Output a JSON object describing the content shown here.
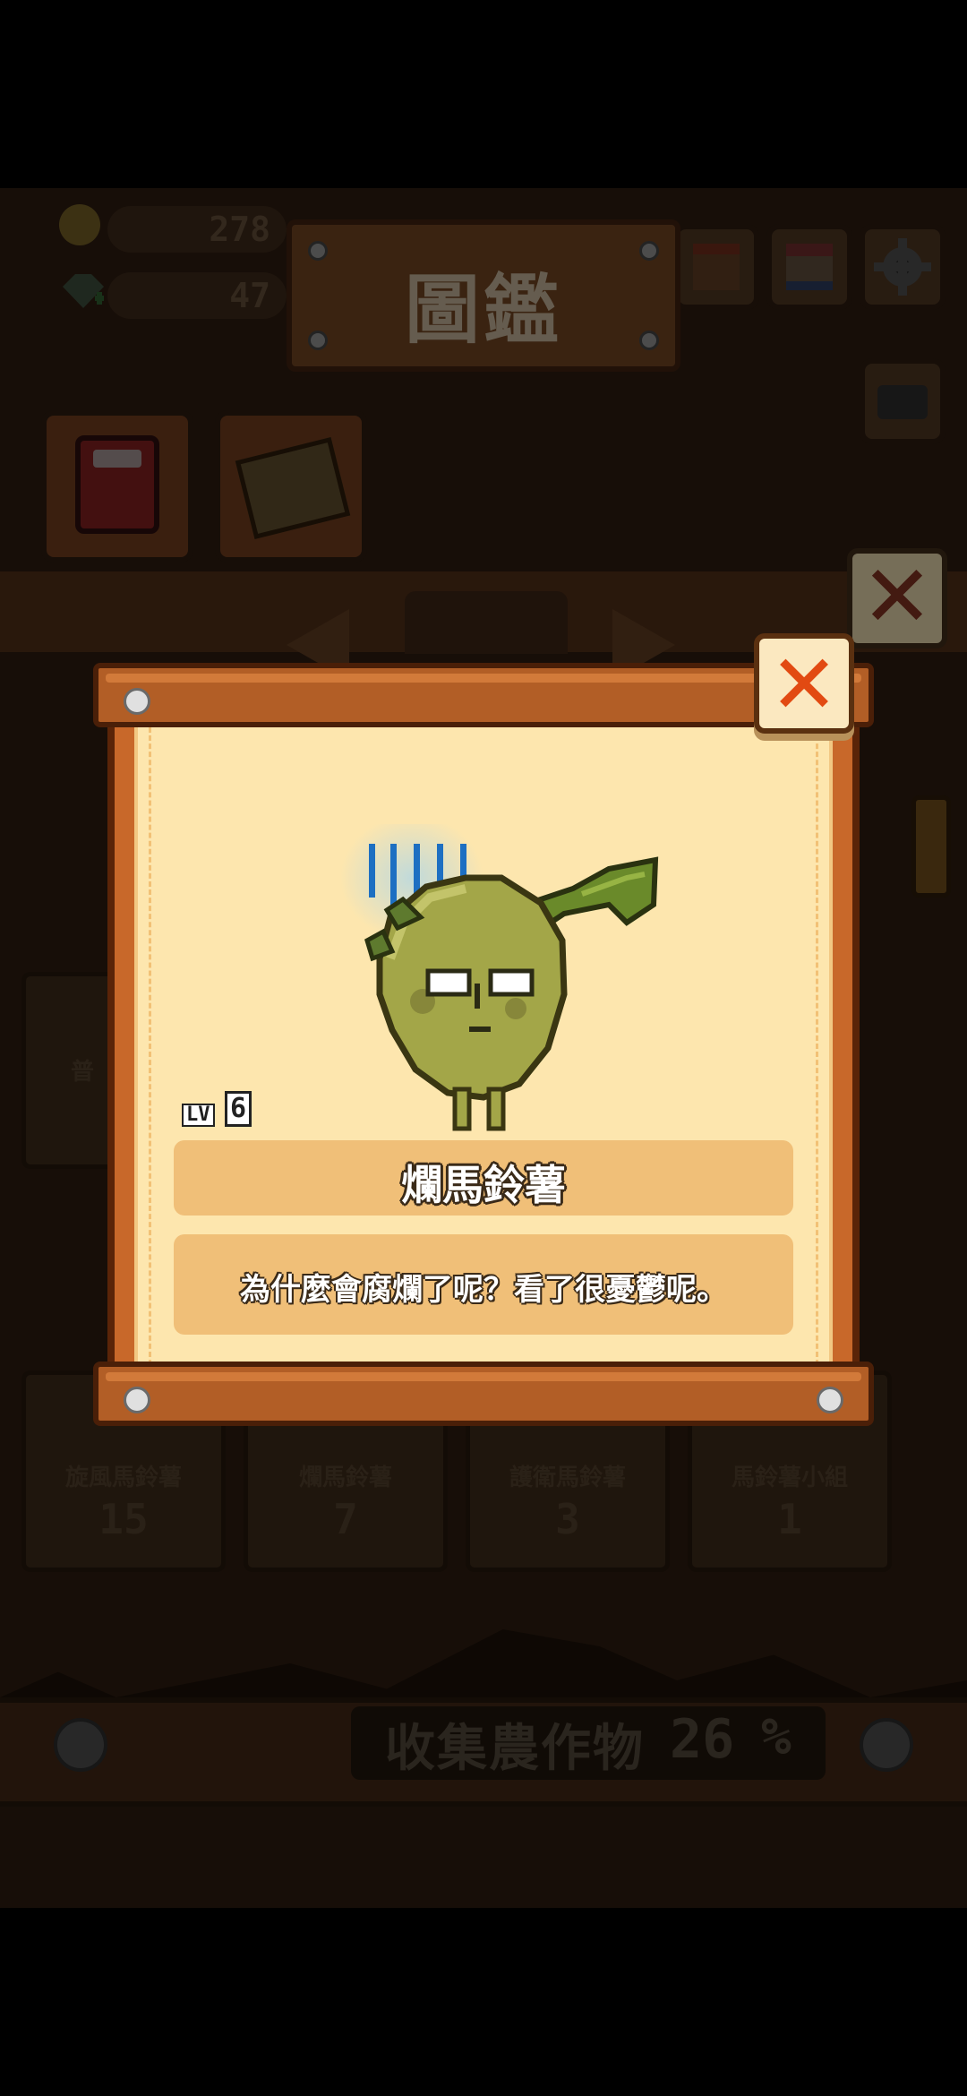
{
  "hud": {
    "coins": "278",
    "gems": "47"
  },
  "title": {
    "text": "圖鑑"
  },
  "collection_cards": [
    {
      "name": "旋風馬鈴薯",
      "count": "15"
    },
    {
      "name": "爛馬鈴薯",
      "count": "7"
    },
    {
      "name": "護衛馬鈴薯",
      "count": "3"
    },
    {
      "name": "馬鈴薯小組",
      "count": "1"
    }
  ],
  "partial_label": "普",
  "collect": {
    "label": "收集農作物",
    "value": "26",
    "unit": "%"
  },
  "popup": {
    "level_label": "LV",
    "level": "6",
    "item_name": "爛馬鈴薯",
    "description": "為什麼會腐爛了呢？看了很憂鬱呢。",
    "close_symbol": "✕"
  },
  "colors": {
    "paper": "#fde6ae",
    "wood": "#b25e26",
    "close_x": "#e24a12",
    "potato": "#a3a648",
    "gloom_lines": "#1d6fc2"
  },
  "icons": {
    "coin": "coin-icon",
    "gem": "gem-icon",
    "book": "book-icon",
    "photos": "photos-icon",
    "settings": "gear-icon",
    "camera": "camera-icon",
    "close": "close-icon",
    "rotten_potato": "rotten-potato-icon"
  }
}
